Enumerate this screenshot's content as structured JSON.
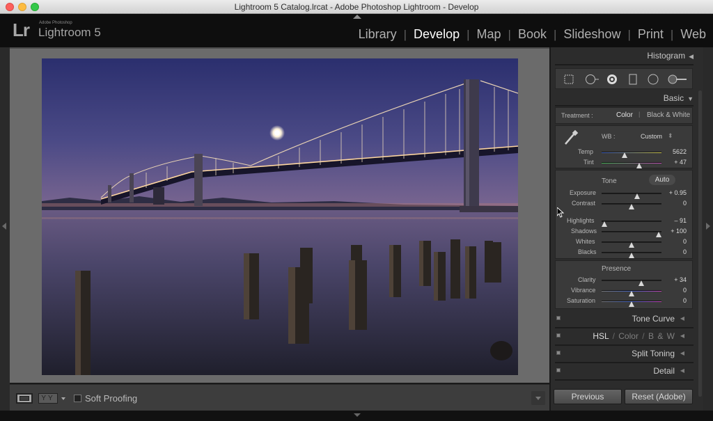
{
  "window": {
    "title": "Lightroom 5 Catalog.lrcat - Adobe Photoshop Lightroom - Develop"
  },
  "identity": {
    "logo": "Lr",
    "adobe": "Adobe Photoshop",
    "product": "Lightroom 5"
  },
  "modules": [
    {
      "label": "Library",
      "active": false
    },
    {
      "label": "Develop",
      "active": true
    },
    {
      "label": "Map",
      "active": false
    },
    {
      "label": "Book",
      "active": false
    },
    {
      "label": "Slideshow",
      "active": false
    },
    {
      "label": "Print",
      "active": false
    },
    {
      "label": "Web",
      "active": false
    }
  ],
  "right_panel": {
    "histogram_label": "Histogram",
    "basic_label": "Basic",
    "treatment": {
      "label": "Treatment :",
      "color": "Color",
      "bw": "Black & White"
    },
    "wb": {
      "label": "WB :",
      "value": "Custom"
    },
    "temp": {
      "label": "Temp",
      "value": "5622",
      "level": 0.38
    },
    "tint": {
      "label": "Tint",
      "value": "+ 47",
      "level": 0.63
    },
    "tone": {
      "label": "Tone",
      "auto": "Auto"
    },
    "exposure": {
      "label": "Exposure",
      "value": "+ 0.95",
      "level": 0.59
    },
    "contrast": {
      "label": "Contrast",
      "value": "0",
      "level": 0.5
    },
    "highlights": {
      "label": "Highlights",
      "value": "– 91",
      "level": 0.05
    },
    "shadows": {
      "label": "Shadows",
      "value": "+ 100",
      "level": 0.95
    },
    "whites": {
      "label": "Whites",
      "value": "0",
      "level": 0.5
    },
    "blacks": {
      "label": "Blacks",
      "value": "0",
      "level": 0.5
    },
    "presence": {
      "label": "Presence"
    },
    "clarity": {
      "label": "Clarity",
      "value": "+ 34",
      "level": 0.66
    },
    "vibrance": {
      "label": "Vibrance",
      "value": "0",
      "level": 0.5
    },
    "saturation": {
      "label": "Saturation",
      "value": "0",
      "level": 0.5
    },
    "tone_curve": "Tone Curve",
    "hsl": {
      "hsl": "HSL",
      "sep1": "/",
      "color": "Color",
      "sep2": "/",
      "bw": "B & W"
    },
    "split_toning": "Split Toning",
    "detail": "Detail",
    "previous": "Previous",
    "reset": "Reset (Adobe)"
  },
  "toolbar": {
    "yy": "YY",
    "soft_proofing": "Soft Proofing"
  },
  "colors": {
    "accent": "#ffffff",
    "panel": "#2c2c2c",
    "canvas": "#6b6b6b"
  }
}
